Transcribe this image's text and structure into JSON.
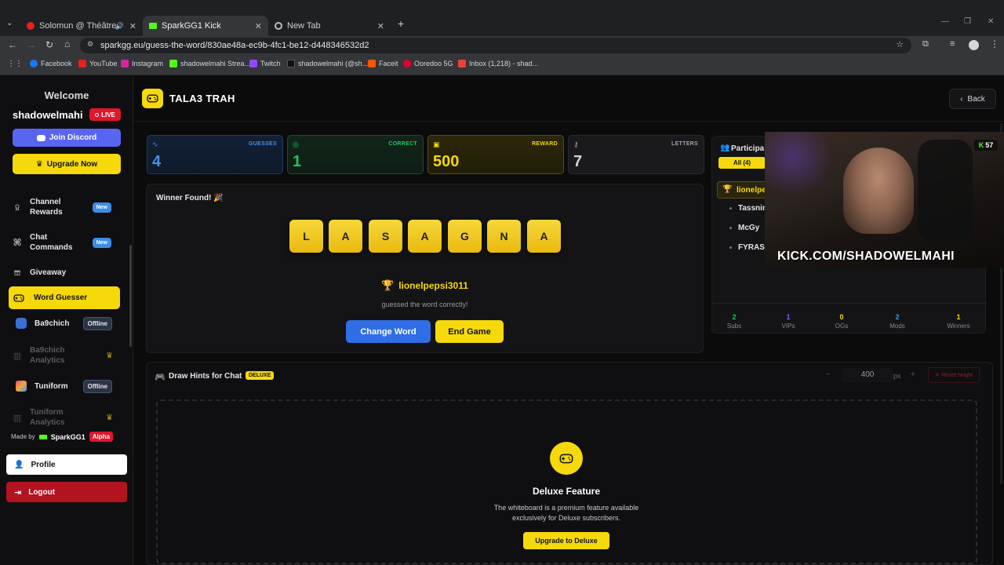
{
  "browser": {
    "tabs": [
      {
        "title": "Solomun @ Théâtre Antiqu",
        "icon": "youtube-icon"
      },
      {
        "title": "SparkGG1 Kick",
        "icon": "kick-icon"
      },
      {
        "title": "New Tab",
        "icon": "chrome-icon"
      }
    ],
    "url": "sparkgg.eu/guess-the-word/830ae48a-ec9b-4fc1-be12-d448346532d2",
    "bookmarks": [
      "Facebook",
      "YouTube",
      "Instagram",
      "shadowelmahi Strea...",
      "Twitch",
      "shadowelmahi (@sh...",
      "Faceit",
      "Ooredoo 5G",
      "Inbox (1,218) - shad..."
    ]
  },
  "sidebar": {
    "welcome": "Welcome",
    "username": "shadowelmahi",
    "live_label": "LIVE",
    "discord_label": "Join Discord",
    "upgrade_label": "Upgrade Now",
    "nav": [
      {
        "label": "Channel Rewards",
        "badge": "New",
        "icon": "award-icon"
      },
      {
        "label": "Chat Commands",
        "badge": "New",
        "icon": "command-icon"
      },
      {
        "label": "Giveaway",
        "badge": "",
        "icon": "gift-icon"
      },
      {
        "label": "Word Guesser",
        "badge": "",
        "icon": "gamepad-icon",
        "active": true
      },
      {
        "label": "Ba9chich",
        "badge": "Offline",
        "icon": "ba9chich-logo-icon"
      },
      {
        "label": "Ba9chich Analytics",
        "badge": "",
        "icon": "bar-chart-icon"
      },
      {
        "label": "Tuniform",
        "badge": "Offline",
        "icon": "tuniform-logo-icon"
      },
      {
        "label": "Tuniform Analytics",
        "badge": "",
        "icon": "bar-chart-icon"
      }
    ],
    "made_by": "Made by",
    "maker": "SparkGG1",
    "alpha": "Alpha",
    "profile_label": "Profile",
    "logout_label": "Logout"
  },
  "header": {
    "title": "TALA3 TRAH",
    "back_label": "Back"
  },
  "stats": [
    {
      "label": "GUESSES",
      "value": "4",
      "color": "#4a90e2"
    },
    {
      "label": "CORRECT",
      "value": "1",
      "color": "#22c55e"
    },
    {
      "label": "REWARD",
      "value": "500",
      "color": "#f5d90a"
    },
    {
      "label": "LETTERS",
      "value": "7",
      "color": "#d4d4d8"
    }
  ],
  "game": {
    "status": "Winner Found! 🎉",
    "letters": [
      "L",
      "A",
      "S",
      "A",
      "G",
      "N",
      "A"
    ],
    "winner": "lionelpepsi3011",
    "guessed_text": "guessed the word correctly!",
    "change_word_label": "Change Word",
    "end_game_label": "End Game"
  },
  "participants": {
    "title": "Participa",
    "filter_all": "All (4)",
    "list": [
      "lionelpe",
      "Tassnim",
      "McGy",
      "FYRAS_"
    ],
    "summary": [
      {
        "n": "2",
        "label": "Subs",
        "color": "#22c55e"
      },
      {
        "n": "1",
        "label": "VIPs",
        "color": "#8b5cf6"
      },
      {
        "n": "0",
        "label": "OGs",
        "color": "#f5d90a"
      },
      {
        "n": "2",
        "label": "Mods",
        "color": "#4a90e2"
      },
      {
        "n": "1",
        "label": "Winners",
        "color": "#f5d90a"
      }
    ]
  },
  "hints": {
    "title": "Draw Hints for Chat",
    "deluxe_badge": "DELUXE",
    "height_value": "400",
    "height_unit": "px",
    "reset_label": "Reset height",
    "feature_title": "Deluxe Feature",
    "feature_desc_1": "The whiteboard is a premium feature available",
    "feature_desc_2": "exclusively for Deluxe subscribers.",
    "upgrade_label": "Upgrade to Deluxe"
  },
  "webcam": {
    "viewer_count": "57",
    "url_text": "KICK.COM/SHADOWELMAHI"
  }
}
